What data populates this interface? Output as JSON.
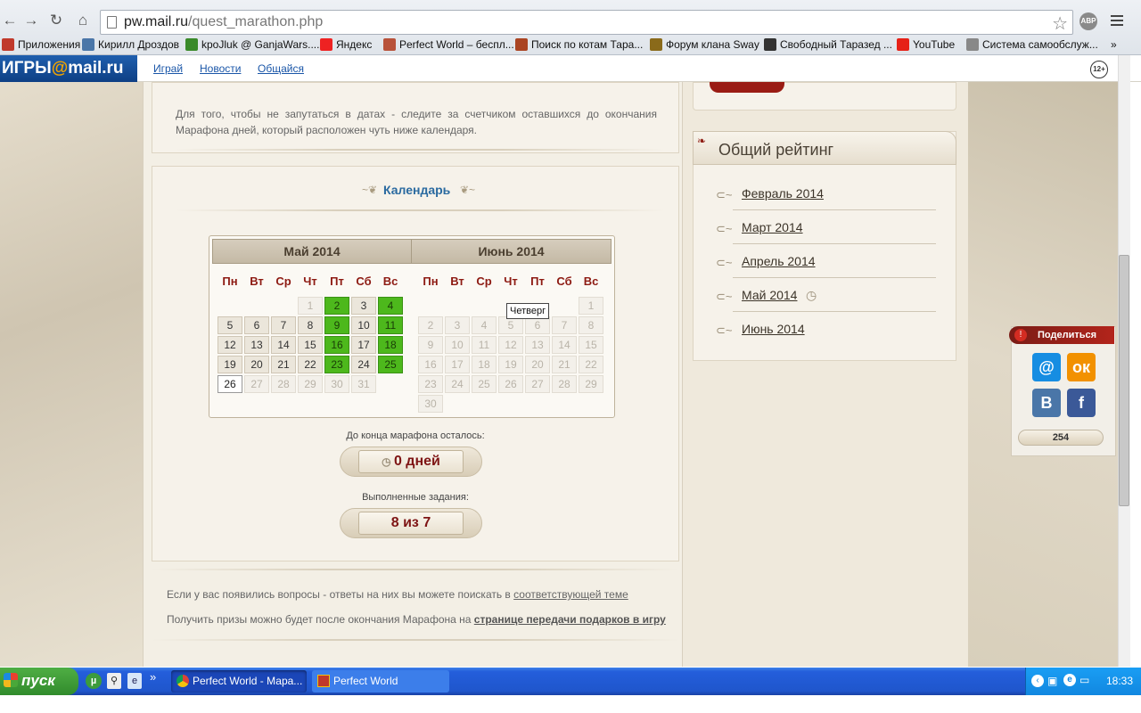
{
  "browser": {
    "url_host": "pw.mail.ru",
    "url_path": "/quest_marathon.php",
    "abp_label": "ABP",
    "bookmarks": [
      {
        "label": "Приложения",
        "icon": "apps-icon"
      },
      {
        "label": "Кирилл Дроздов",
        "icon": "vk-icon"
      },
      {
        "label": "kpoJluk @ GanjaWars....",
        "icon": "star-icon"
      },
      {
        "label": "Яндекс",
        "icon": "yandex-icon"
      },
      {
        "label": "Perfect World – беспл...",
        "icon": "pw-icon"
      },
      {
        "label": "Поиск по котам Тара...",
        "icon": "cat-icon"
      },
      {
        "label": "Форум клана Sway",
        "icon": "forum-icon"
      },
      {
        "label": "Свободный Таразед ...",
        "icon": "taraz-icon"
      },
      {
        "label": "YouTube",
        "icon": "youtube-icon"
      },
      {
        "label": "Система самообслуж...",
        "icon": "page-icon"
      }
    ],
    "bookmarks_more": "»"
  },
  "site": {
    "logo_prefix": "ИГРЫ",
    "logo_at": "@",
    "logo_suffix": "mail.ru",
    "nav": [
      "Играй",
      "Новости",
      "Общайся"
    ],
    "age_badge": "12+"
  },
  "intro": {
    "text": "Для того, чтобы не запутаться в датах - следите за счетчиком оставшихся до окончания Марафона дней, который расположен чуть ниже календаря."
  },
  "calendar": {
    "title": "Календарь",
    "weekdays": [
      "Пн",
      "Вт",
      "Ср",
      "Чт",
      "Пт",
      "Сб",
      "Вс"
    ],
    "months": [
      {
        "name": "Май 2014",
        "weeks": [
          [
            null,
            null,
            null,
            {
              "d": "1",
              "s": "dim"
            },
            {
              "d": "2",
              "s": "green"
            },
            {
              "d": "3",
              "s": "norm"
            },
            {
              "d": "4",
              "s": "green"
            }
          ],
          [
            {
              "d": "5",
              "s": "norm"
            },
            {
              "d": "6",
              "s": "norm"
            },
            {
              "d": "7",
              "s": "norm"
            },
            {
              "d": "8",
              "s": "norm"
            },
            {
              "d": "9",
              "s": "green"
            },
            {
              "d": "10",
              "s": "norm"
            },
            {
              "d": "11",
              "s": "green"
            }
          ],
          [
            {
              "d": "12",
              "s": "norm"
            },
            {
              "d": "13",
              "s": "norm"
            },
            {
              "d": "14",
              "s": "norm"
            },
            {
              "d": "15",
              "s": "norm"
            },
            {
              "d": "16",
              "s": "green"
            },
            {
              "d": "17",
              "s": "norm"
            },
            {
              "d": "18",
              "s": "green"
            }
          ],
          [
            {
              "d": "19",
              "s": "norm"
            },
            {
              "d": "20",
              "s": "norm"
            },
            {
              "d": "21",
              "s": "norm"
            },
            {
              "d": "22",
              "s": "norm"
            },
            {
              "d": "23",
              "s": "green"
            },
            {
              "d": "24",
              "s": "norm"
            },
            {
              "d": "25",
              "s": "green"
            }
          ],
          [
            {
              "d": "26",
              "s": "today"
            },
            {
              "d": "27",
              "s": "dim"
            },
            {
              "d": "28",
              "s": "dim"
            },
            {
              "d": "29",
              "s": "dim"
            },
            {
              "d": "30",
              "s": "dim"
            },
            {
              "d": "31",
              "s": "dim"
            },
            null
          ]
        ]
      },
      {
        "name": "Июнь 2014",
        "weeks": [
          [
            null,
            null,
            null,
            null,
            null,
            null,
            {
              "d": "1",
              "s": "dim"
            }
          ],
          [
            {
              "d": "2",
              "s": "dim"
            },
            {
              "d": "3",
              "s": "dim"
            },
            {
              "d": "4",
              "s": "dim"
            },
            {
              "d": "5",
              "s": "dim"
            },
            {
              "d": "6",
              "s": "dim"
            },
            {
              "d": "7",
              "s": "dim"
            },
            {
              "d": "8",
              "s": "dim"
            }
          ],
          [
            {
              "d": "9",
              "s": "dim"
            },
            {
              "d": "10",
              "s": "dim"
            },
            {
              "d": "11",
              "s": "dim"
            },
            {
              "d": "12",
              "s": "dim"
            },
            {
              "d": "13",
              "s": "dim"
            },
            {
              "d": "14",
              "s": "dim"
            },
            {
              "d": "15",
              "s": "dim"
            }
          ],
          [
            {
              "d": "16",
              "s": "dim"
            },
            {
              "d": "17",
              "s": "dim"
            },
            {
              "d": "18",
              "s": "dim"
            },
            {
              "d": "19",
              "s": "dim"
            },
            {
              "d": "20",
              "s": "dim"
            },
            {
              "d": "21",
              "s": "dim"
            },
            {
              "d": "22",
              "s": "dim"
            }
          ],
          [
            {
              "d": "23",
              "s": "dim"
            },
            {
              "d": "24",
              "s": "dim"
            },
            {
              "d": "25",
              "s": "dim"
            },
            {
              "d": "26",
              "s": "dim"
            },
            {
              "d": "27",
              "s": "dim"
            },
            {
              "d": "28",
              "s": "dim"
            },
            {
              "d": "29",
              "s": "dim"
            }
          ],
          [
            {
              "d": "30",
              "s": "dim"
            },
            null,
            null,
            null,
            null,
            null,
            null
          ]
        ]
      }
    ],
    "tooltip": "Четверг",
    "remaining_label": "До конца марафона осталось:",
    "remaining_value": "0 дней",
    "tasks_label": "Выполненные задания:",
    "tasks_value": "8 из 7"
  },
  "footer": {
    "q_text": "Если у вас появились вопросы - ответы на них вы можете поискать в ",
    "q_link": "соответствующей теме",
    "p_text": "Получить призы можно будет после окончания Марафона на ",
    "p_link": "странице передачи подарков в игру"
  },
  "rating": {
    "title": "Общий рейтинг",
    "items": [
      "Февраль 2014",
      "Март 2014",
      "Апрель 2014",
      "Май 2014",
      "Июнь 2014"
    ]
  },
  "share": {
    "label": "Поделиться",
    "buttons": [
      {
        "name": "mailru",
        "glyph": "@",
        "color": "#168de2"
      },
      {
        "name": "odnoklassniki",
        "glyph": "ок",
        "color": "#f29100"
      },
      {
        "name": "vkontakte",
        "glyph": "B",
        "color": "#4a76a8"
      },
      {
        "name": "facebook",
        "glyph": "f",
        "color": "#3b5998"
      }
    ],
    "count": "254"
  },
  "taskbar": {
    "start_label": "пуск",
    "tasks": [
      "Perfect World - Мара...",
      "Perfect World"
    ],
    "more": "»",
    "clock": "18:33"
  }
}
